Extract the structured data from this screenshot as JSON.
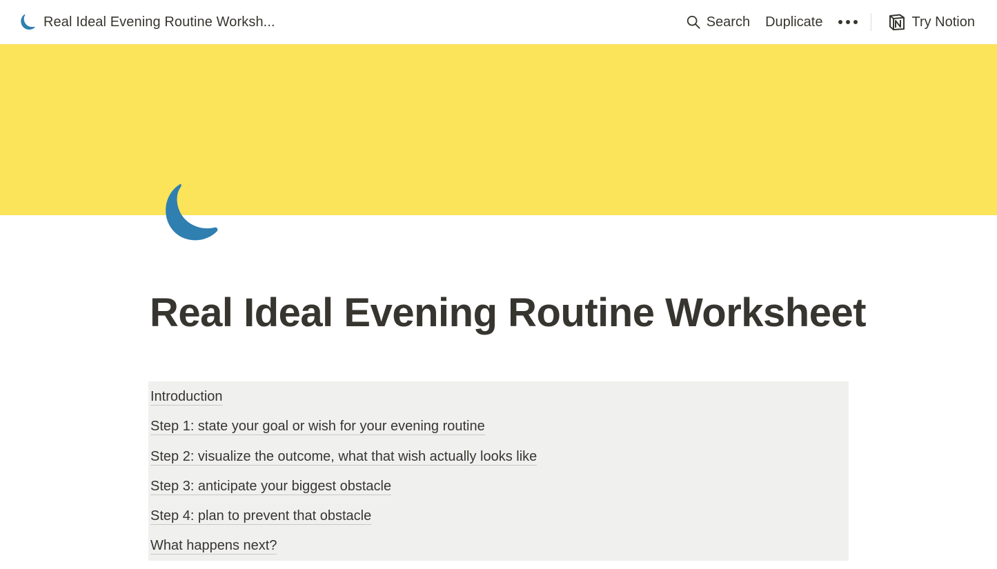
{
  "topbar": {
    "breadcrumb_title": "Real Ideal Evening Routine Worksh...",
    "breadcrumb_icon": "crescent-moon-icon",
    "search_label": "Search",
    "duplicate_label": "Duplicate",
    "more_icon": "ellipsis-icon",
    "try_notion_label": "Try Notion",
    "notion_logo_icon": "notion-logo-icon"
  },
  "cover": {
    "color": "#fbe35a"
  },
  "page": {
    "icon": "crescent-moon-icon",
    "icon_color": "#2f7fb1",
    "title": "Real Ideal Evening Routine Worksheet"
  },
  "toc": {
    "items": [
      "Introduction",
      "Step 1: state your goal or wish for your evening routine",
      "Step 2: visualize the outcome, what that wish actually looks like",
      "Step 3: anticipate your biggest obstacle",
      "Step 4: plan to prevent that obstacle",
      "What happens next?"
    ]
  }
}
